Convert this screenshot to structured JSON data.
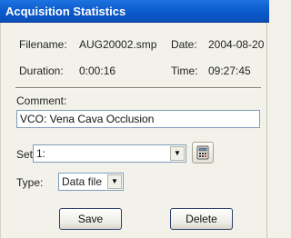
{
  "window": {
    "title": "Acquisition Statistics"
  },
  "info": {
    "filename_label": "Filename:",
    "filename_value": "AUG20002.smp",
    "date_label": "Date:",
    "date_value": "2004-08-20",
    "duration_label": "Duration:",
    "duration_value": "0:00:16",
    "time_label": "Time:",
    "time_value": "09:27:45"
  },
  "comment": {
    "label": "Comment:",
    "value": "VCO: Vena Cava Occlusion"
  },
  "set": {
    "label": "Set:",
    "value": "1:"
  },
  "type": {
    "label": "Type:",
    "value": "Data file"
  },
  "buttons": {
    "save": "Save",
    "delete": "Delete"
  },
  "icons": {
    "set_action": "calculator-icon"
  }
}
